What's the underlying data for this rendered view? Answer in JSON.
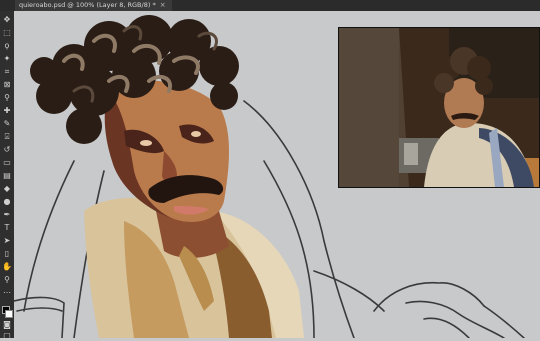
{
  "document": {
    "tab_title": "quieroabo.psd @ 100% (Layer 8, RGB/8) *",
    "close_symbol": "×"
  },
  "toolbar": {
    "tools": [
      {
        "icon": "move-icon",
        "glyph": "✥"
      },
      {
        "icon": "marquee-icon",
        "glyph": "⬚"
      },
      {
        "icon": "lasso-icon",
        "glyph": "ϙ"
      },
      {
        "icon": "magic-wand-icon",
        "glyph": "✦"
      },
      {
        "icon": "crop-icon",
        "glyph": "⌗"
      },
      {
        "icon": "frame-icon",
        "glyph": "⊠"
      },
      {
        "icon": "eyedropper-icon",
        "glyph": "⚲"
      },
      {
        "icon": "healing-brush-icon",
        "glyph": "✚"
      },
      {
        "icon": "brush-icon",
        "glyph": "✎"
      },
      {
        "icon": "clone-stamp-icon",
        "glyph": "⍓"
      },
      {
        "icon": "history-brush-icon",
        "glyph": "↺"
      },
      {
        "icon": "eraser-icon",
        "glyph": "▭"
      },
      {
        "icon": "gradient-icon",
        "glyph": "▤"
      },
      {
        "icon": "blur-icon",
        "glyph": "◆"
      },
      {
        "icon": "dodge-icon",
        "glyph": "●"
      },
      {
        "icon": "pen-icon",
        "glyph": "✒"
      },
      {
        "icon": "type-icon",
        "glyph": "T"
      },
      {
        "icon": "path-selection-icon",
        "glyph": "➤"
      },
      {
        "icon": "rectangle-icon",
        "glyph": "▯"
      },
      {
        "icon": "hand-icon",
        "glyph": "✋"
      },
      {
        "icon": "zoom-icon",
        "glyph": "⚲"
      },
      {
        "icon": "more-tools-icon",
        "glyph": "⋯"
      }
    ],
    "foreground_color": "#000000",
    "background_color": "#ffffff"
  },
  "colors": {
    "canvas_bg": "#c8c9cb",
    "ui_dark": "#2f2f2f",
    "skin": "#b97a4c",
    "skin_shadow": "#6b3524",
    "hair": "#2a1d16",
    "shirt": "#d8c39b",
    "vest": "#c59b60"
  }
}
